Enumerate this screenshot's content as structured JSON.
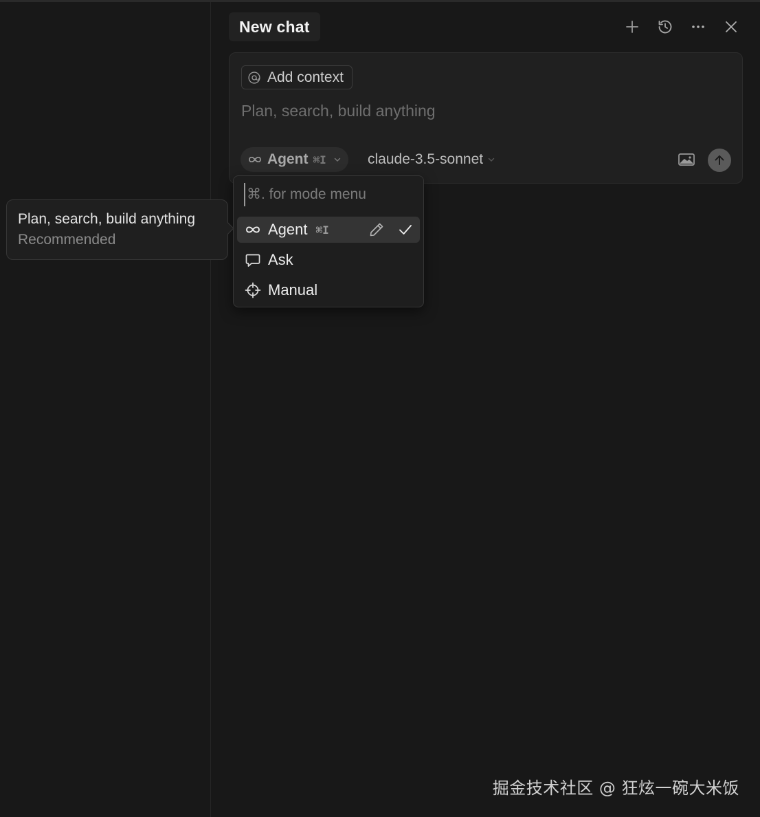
{
  "header": {
    "tab_title": "New chat",
    "actions": [
      {
        "name": "new-chat",
        "icon": "plus-icon"
      },
      {
        "name": "history",
        "icon": "history-icon"
      },
      {
        "name": "more",
        "icon": "ellipsis-icon"
      },
      {
        "name": "close",
        "icon": "close-icon"
      }
    ]
  },
  "composer": {
    "add_context_label": "Add context",
    "add_context_icon": "at-icon",
    "input_placeholder": "Plan, search, build anything",
    "mode": {
      "label": "Agent",
      "shortcut": "⌘I",
      "icon": "infinity-icon"
    },
    "model": {
      "label": "claude-3.5-sonnet"
    },
    "image_icon": "image-icon",
    "send_icon": "arrow-up-icon"
  },
  "mode_menu": {
    "search_placeholder": "⌘. for mode menu",
    "items": [
      {
        "label": "Agent",
        "shortcut": "⌘I",
        "icon": "infinity-icon",
        "selected": true
      },
      {
        "label": "Ask",
        "icon": "chat-bubble-icon",
        "selected": false
      },
      {
        "label": "Manual",
        "icon": "crosshair-icon",
        "selected": false
      }
    ]
  },
  "tooltip": {
    "title": "Plan, search, build anything",
    "subtitle": "Recommended"
  },
  "watermark": "掘金技术社区 @ 狂炫一碗大米饭",
  "colors": {
    "background": "#181818",
    "panel": "#202020",
    "menu_active": "#343434",
    "text_primary": "#ececec",
    "text_muted": "#7b7b7b"
  }
}
